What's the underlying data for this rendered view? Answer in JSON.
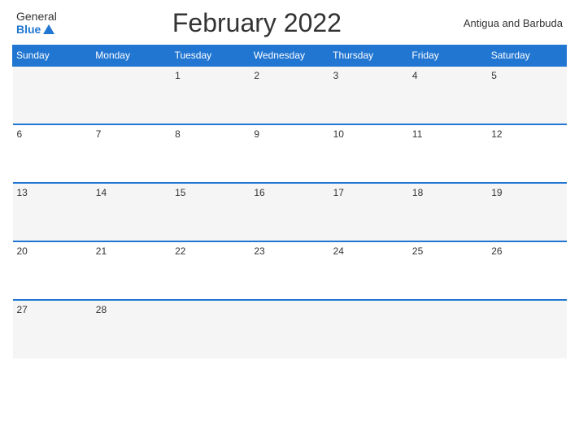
{
  "header": {
    "logo_general": "General",
    "logo_blue": "Blue",
    "title": "February 2022",
    "country": "Antigua and Barbuda"
  },
  "days_of_week": [
    "Sunday",
    "Monday",
    "Tuesday",
    "Wednesday",
    "Thursday",
    "Friday",
    "Saturday"
  ],
  "weeks": [
    [
      "",
      "",
      "1",
      "2",
      "3",
      "4",
      "5"
    ],
    [
      "6",
      "7",
      "8",
      "9",
      "10",
      "11",
      "12"
    ],
    [
      "13",
      "14",
      "15",
      "16",
      "17",
      "18",
      "19"
    ],
    [
      "20",
      "21",
      "22",
      "23",
      "24",
      "25",
      "26"
    ],
    [
      "27",
      "28",
      "",
      "",
      "",
      "",
      ""
    ]
  ]
}
